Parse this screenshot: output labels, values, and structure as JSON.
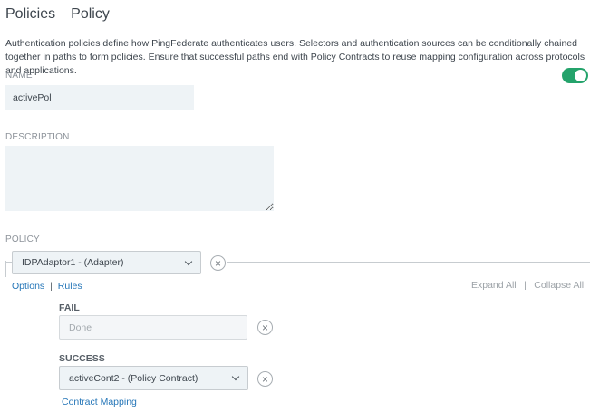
{
  "header": {
    "title_primary": "Policies",
    "title_secondary": "Policy"
  },
  "intro_text": "Authentication policies define how PingFederate authenticates users. Selectors and authentication sources can be conditionally chained together in paths to form policies. Ensure that successful paths end with Policy Contracts to reuse mapping configuration across protocols and applications.",
  "name_field": {
    "label": "NAME",
    "value": "activePol",
    "enabled": true
  },
  "description_field": {
    "label": "DESCRIPTION",
    "value": ""
  },
  "policy": {
    "label": "POLICY",
    "root_selected": "IDPAdaptor1 - (Adapter)",
    "options_link": "Options",
    "link_separator": "|",
    "rules_link": "Rules",
    "expand_all": "Expand All",
    "collapse_all": "Collapse All",
    "expand_separator": "|",
    "fail": {
      "label": "FAIL",
      "placeholder": "Done"
    },
    "success": {
      "label": "SUCCESS",
      "selected": "activeCont2 - (Policy Contract)",
      "contract_mapping_link": "Contract Mapping"
    }
  },
  "colors": {
    "toggle_on": "#24a36b",
    "link": "#2576b8",
    "field_bg": "#eef3f6"
  },
  "icons": {
    "close": "×"
  }
}
